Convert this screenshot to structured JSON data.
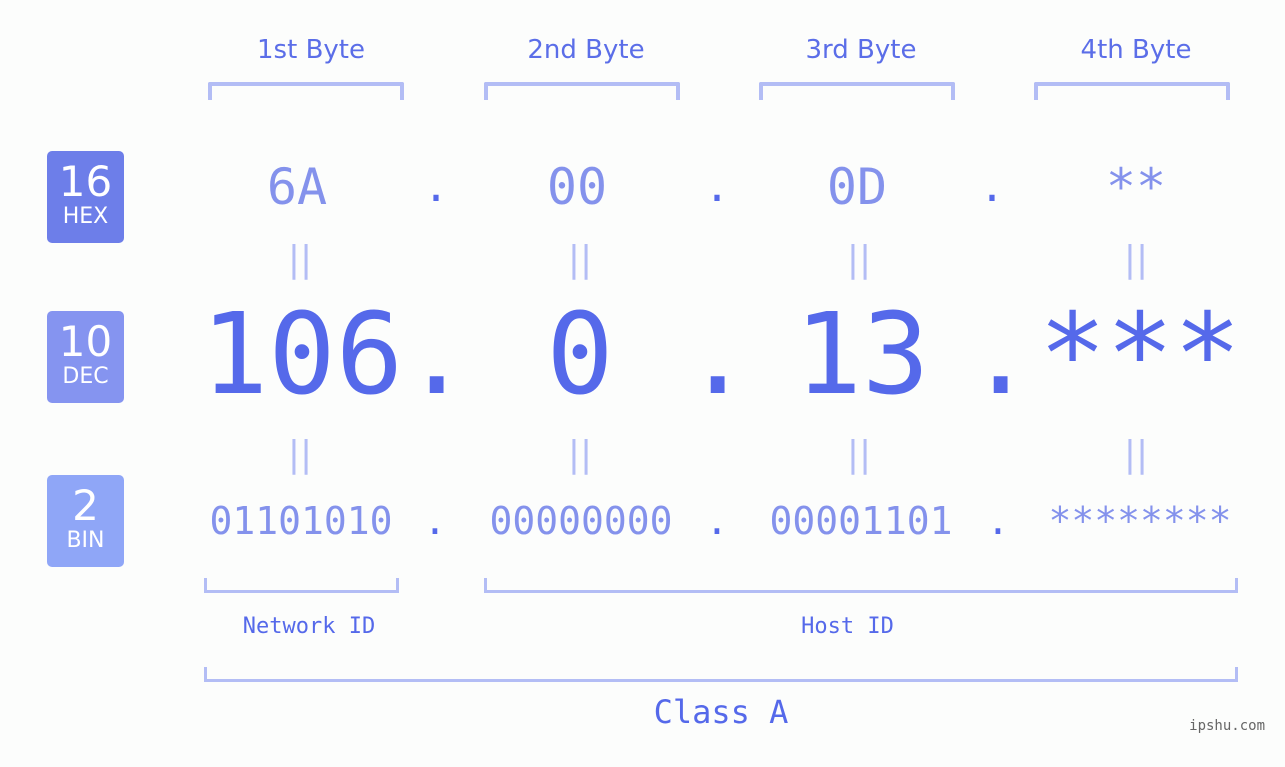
{
  "badges": [
    {
      "num": "16",
      "label": "HEX",
      "color": "#6d7ee9"
    },
    {
      "num": "10",
      "label": "DEC",
      "color": "#8594f0"
    },
    {
      "num": "2",
      "label": "BIN",
      "color": "#8fa6f7"
    }
  ],
  "byte_headers": [
    "1st Byte",
    "2nd Byte",
    "3rd Byte",
    "4th Byte"
  ],
  "hex": [
    "6A",
    "00",
    "0D",
    "**"
  ],
  "dec": [
    "106",
    "0",
    "13",
    "***"
  ],
  "bin": [
    "01101010",
    "00000000",
    "00001101",
    "********"
  ],
  "separator": ".",
  "equals": "||",
  "network_id_label": "Network ID",
  "host_id_label": "Host ID",
  "class_label": "Class A",
  "watermark": "ipshu.com",
  "colors": {
    "primary": "#5569ea",
    "light": "#8492ec",
    "bracket": "#b3bdf5"
  }
}
